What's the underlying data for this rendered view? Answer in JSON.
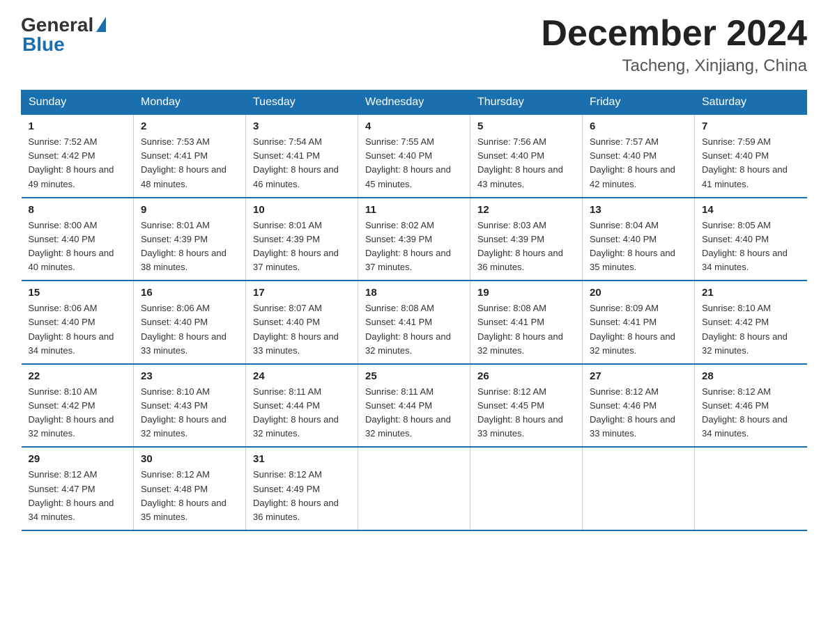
{
  "header": {
    "logo_general": "General",
    "logo_blue": "Blue",
    "month_title": "December 2024",
    "location": "Tacheng, Xinjiang, China"
  },
  "weekdays": [
    "Sunday",
    "Monday",
    "Tuesday",
    "Wednesday",
    "Thursday",
    "Friday",
    "Saturday"
  ],
  "weeks": [
    [
      {
        "day": "1",
        "sunrise": "7:52 AM",
        "sunset": "4:42 PM",
        "daylight": "8 hours and 49 minutes."
      },
      {
        "day": "2",
        "sunrise": "7:53 AM",
        "sunset": "4:41 PM",
        "daylight": "8 hours and 48 minutes."
      },
      {
        "day": "3",
        "sunrise": "7:54 AM",
        "sunset": "4:41 PM",
        "daylight": "8 hours and 46 minutes."
      },
      {
        "day": "4",
        "sunrise": "7:55 AM",
        "sunset": "4:40 PM",
        "daylight": "8 hours and 45 minutes."
      },
      {
        "day": "5",
        "sunrise": "7:56 AM",
        "sunset": "4:40 PM",
        "daylight": "8 hours and 43 minutes."
      },
      {
        "day": "6",
        "sunrise": "7:57 AM",
        "sunset": "4:40 PM",
        "daylight": "8 hours and 42 minutes."
      },
      {
        "day": "7",
        "sunrise": "7:59 AM",
        "sunset": "4:40 PM",
        "daylight": "8 hours and 41 minutes."
      }
    ],
    [
      {
        "day": "8",
        "sunrise": "8:00 AM",
        "sunset": "4:40 PM",
        "daylight": "8 hours and 40 minutes."
      },
      {
        "day": "9",
        "sunrise": "8:01 AM",
        "sunset": "4:39 PM",
        "daylight": "8 hours and 38 minutes."
      },
      {
        "day": "10",
        "sunrise": "8:01 AM",
        "sunset": "4:39 PM",
        "daylight": "8 hours and 37 minutes."
      },
      {
        "day": "11",
        "sunrise": "8:02 AM",
        "sunset": "4:39 PM",
        "daylight": "8 hours and 37 minutes."
      },
      {
        "day": "12",
        "sunrise": "8:03 AM",
        "sunset": "4:39 PM",
        "daylight": "8 hours and 36 minutes."
      },
      {
        "day": "13",
        "sunrise": "8:04 AM",
        "sunset": "4:40 PM",
        "daylight": "8 hours and 35 minutes."
      },
      {
        "day": "14",
        "sunrise": "8:05 AM",
        "sunset": "4:40 PM",
        "daylight": "8 hours and 34 minutes."
      }
    ],
    [
      {
        "day": "15",
        "sunrise": "8:06 AM",
        "sunset": "4:40 PM",
        "daylight": "8 hours and 34 minutes."
      },
      {
        "day": "16",
        "sunrise": "8:06 AM",
        "sunset": "4:40 PM",
        "daylight": "8 hours and 33 minutes."
      },
      {
        "day": "17",
        "sunrise": "8:07 AM",
        "sunset": "4:40 PM",
        "daylight": "8 hours and 33 minutes."
      },
      {
        "day": "18",
        "sunrise": "8:08 AM",
        "sunset": "4:41 PM",
        "daylight": "8 hours and 32 minutes."
      },
      {
        "day": "19",
        "sunrise": "8:08 AM",
        "sunset": "4:41 PM",
        "daylight": "8 hours and 32 minutes."
      },
      {
        "day": "20",
        "sunrise": "8:09 AM",
        "sunset": "4:41 PM",
        "daylight": "8 hours and 32 minutes."
      },
      {
        "day": "21",
        "sunrise": "8:10 AM",
        "sunset": "4:42 PM",
        "daylight": "8 hours and 32 minutes."
      }
    ],
    [
      {
        "day": "22",
        "sunrise": "8:10 AM",
        "sunset": "4:42 PM",
        "daylight": "8 hours and 32 minutes."
      },
      {
        "day": "23",
        "sunrise": "8:10 AM",
        "sunset": "4:43 PM",
        "daylight": "8 hours and 32 minutes."
      },
      {
        "day": "24",
        "sunrise": "8:11 AM",
        "sunset": "4:44 PM",
        "daylight": "8 hours and 32 minutes."
      },
      {
        "day": "25",
        "sunrise": "8:11 AM",
        "sunset": "4:44 PM",
        "daylight": "8 hours and 32 minutes."
      },
      {
        "day": "26",
        "sunrise": "8:12 AM",
        "sunset": "4:45 PM",
        "daylight": "8 hours and 33 minutes."
      },
      {
        "day": "27",
        "sunrise": "8:12 AM",
        "sunset": "4:46 PM",
        "daylight": "8 hours and 33 minutes."
      },
      {
        "day": "28",
        "sunrise": "8:12 AM",
        "sunset": "4:46 PM",
        "daylight": "8 hours and 34 minutes."
      }
    ],
    [
      {
        "day": "29",
        "sunrise": "8:12 AM",
        "sunset": "4:47 PM",
        "daylight": "8 hours and 34 minutes."
      },
      {
        "day": "30",
        "sunrise": "8:12 AM",
        "sunset": "4:48 PM",
        "daylight": "8 hours and 35 minutes."
      },
      {
        "day": "31",
        "sunrise": "8:12 AM",
        "sunset": "4:49 PM",
        "daylight": "8 hours and 36 minutes."
      },
      null,
      null,
      null,
      null
    ]
  ]
}
